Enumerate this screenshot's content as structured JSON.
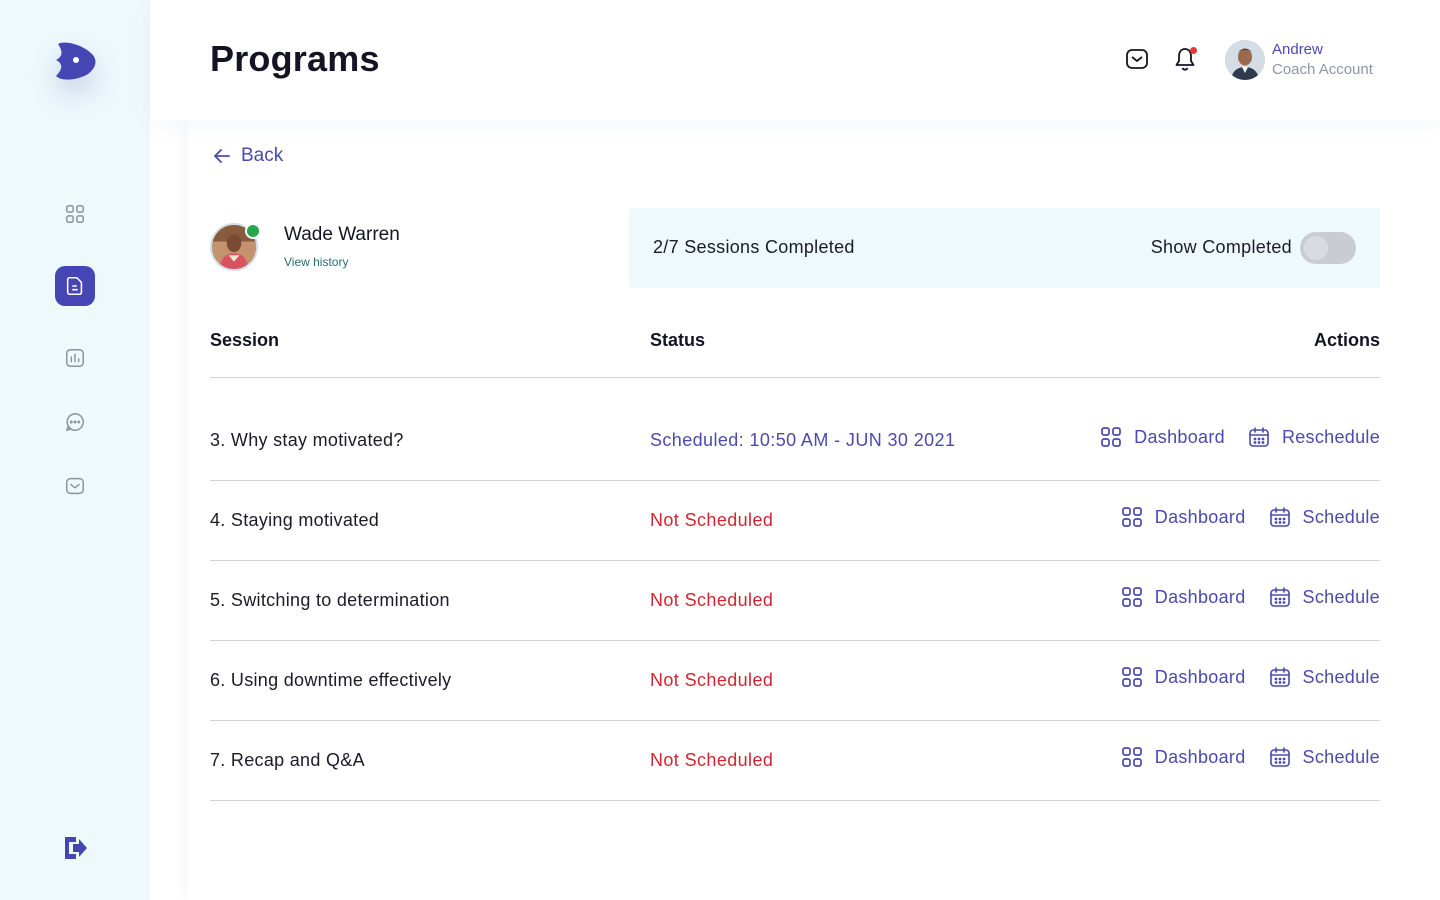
{
  "header": {
    "title": "Programs",
    "user": {
      "name": "Andrew",
      "role": "Coach Account"
    }
  },
  "sidebar": {
    "items": [
      {
        "name": "dashboard",
        "icon": "grid-icon",
        "active": false
      },
      {
        "name": "programs",
        "icon": "document-icon",
        "active": true
      },
      {
        "name": "analytics",
        "icon": "chart-icon",
        "active": false
      },
      {
        "name": "messages",
        "icon": "chat-icon",
        "active": false
      },
      {
        "name": "inbox",
        "icon": "inbox-icon",
        "active": false
      }
    ],
    "logout_icon": "logout-icon"
  },
  "main": {
    "back_label": "Back",
    "client": {
      "name": "Wade Warren",
      "history_link": "View history",
      "online": true
    },
    "summary": {
      "sessions_text": "2/7 Sessions Completed",
      "show_completed_label": "Show Completed",
      "show_completed": false
    },
    "table": {
      "headers": {
        "session": "Session",
        "status": "Status",
        "actions": "Actions"
      },
      "rows": [
        {
          "session": "3. Why stay motivated?",
          "status": "Scheduled: 10:50 AM - JUN 30 2021",
          "status_type": "scheduled",
          "action1": "Dashboard",
          "action2": "Reschedule"
        },
        {
          "session": "4. Staying motivated",
          "status": "Not Scheduled",
          "status_type": "not",
          "action1": "Dashboard",
          "action2": "Schedule"
        },
        {
          "session": "5. Switching to determination",
          "status": "Not Scheduled",
          "status_type": "not",
          "action1": "Dashboard",
          "action2": "Schedule"
        },
        {
          "session": "6. Using downtime effectively",
          "status": "Not Scheduled",
          "status_type": "not",
          "action1": "Dashboard",
          "action2": "Schedule"
        },
        {
          "session": "7. Recap and Q&A",
          "status": "Not Scheduled",
          "status_type": "not",
          "action1": "Dashboard",
          "action2": "Schedule"
        }
      ]
    }
  },
  "colors": {
    "accent": "#4545b4",
    "link": "#4a4ab0",
    "danger": "#d0262e",
    "sidebar_bg": "#eef9fc",
    "online": "#26a64a"
  }
}
